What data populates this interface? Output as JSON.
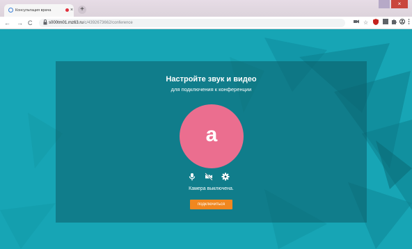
{
  "browser": {
    "tab_title": "Консультация врача",
    "new_tab": "+",
    "close_tab": "×",
    "window_close": "×",
    "url_host": "s000tm01.mz63.ru",
    "url_path": "/c/4392673662/conference",
    "nav": {
      "back": "←",
      "forward": "→",
      "reload": "C"
    },
    "ext_icons": [
      "camera-icon",
      "star-icon",
      "shield-icon",
      "grid-icon",
      "puzzle-icon",
      "profile-icon",
      "menu-icon"
    ]
  },
  "conference": {
    "title": "Настройте звук и видео",
    "subtitle": "для подключения к конференции",
    "avatar_letter": "a",
    "status": "Камера выключена.",
    "connect_button": "подключиться",
    "controls": [
      "microphone-icon",
      "camera-off-icon",
      "settings-icon"
    ]
  },
  "colors": {
    "background": "#17a5b5",
    "panel": "#0b5c68",
    "avatar": "#eb6e8f",
    "button": "#f0871f"
  }
}
